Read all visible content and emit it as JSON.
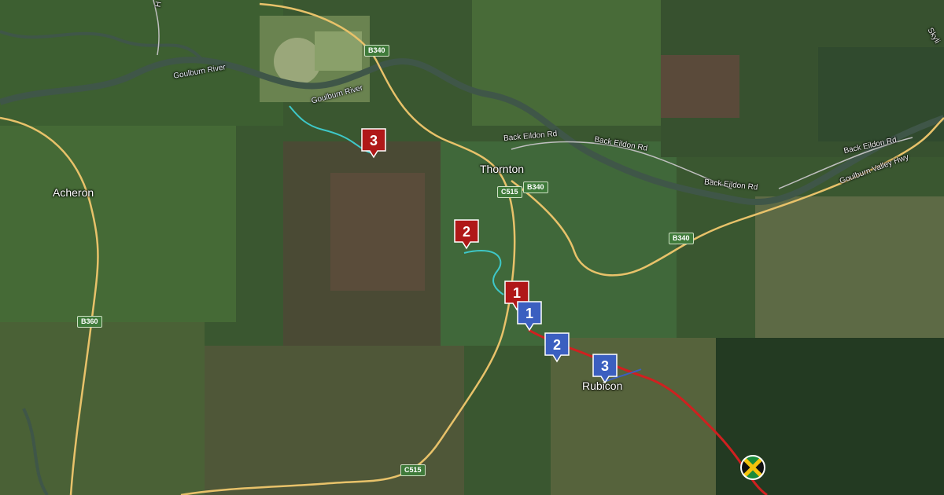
{
  "places": {
    "thornton": "Thornton",
    "acheron": "Acheron",
    "rubicon": "Rubicon"
  },
  "rivers": {
    "goulburn_1": "Goulburn River",
    "goulburn_2": "Goulburn River"
  },
  "roads": {
    "back_eildon_1": "Back Eildon Rd",
    "back_eildon_2": "Back Eildon Rd",
    "back_eildon_3": "Back Eildon Rd",
    "back_eildon_4": "Back Eildon Rd",
    "goulburn_valley_hwy": "Goulburn Valley Hwy",
    "skyline_partial": "Skyli",
    "h_partial": "H"
  },
  "shields": {
    "b340_top": "B340",
    "c515_north": "C515",
    "b340_mid": "B340",
    "b340_east": "B340",
    "b360": "B360",
    "c515_south": "C515"
  },
  "markers": {
    "red": [
      {
        "label": "3"
      },
      {
        "label": "2"
      },
      {
        "label": "1"
      }
    ],
    "blue": [
      {
        "label": "1"
      },
      {
        "label": "2"
      },
      {
        "label": "3"
      }
    ]
  },
  "colors": {
    "red_marker": "#b01818",
    "blue_marker": "#3b5fc0",
    "route_red": "#d02020",
    "route_teal": "#3ec8c8",
    "road_yellow": "#e8c26a",
    "river": "#4a5a50"
  },
  "icons": {
    "flag": "jamaica-flag-icon"
  }
}
